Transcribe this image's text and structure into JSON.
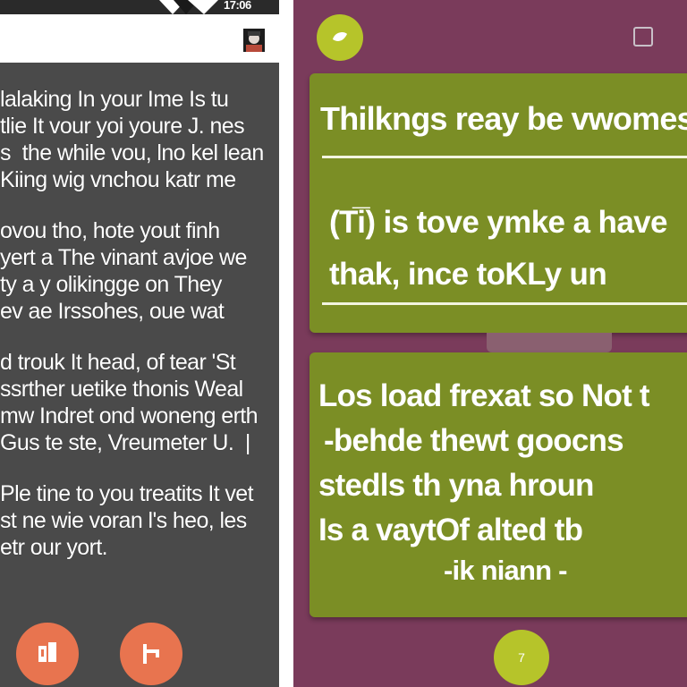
{
  "left": {
    "status_text": "17:06",
    "paragraphs": [
      [
        "lalaking In your Ime Is tu",
        "tlie It vour yoi youre J. nes",
        "s  the while vou, lno kel lean",
        "Kiing wig vnchou katr me"
      ],
      [
        "ovou tho, hote yout finh",
        "yert a The vinant avjoe we",
        "ty a y olikingge on They",
        "ev ae Irssohes, oue wat"
      ],
      [
        "d trouk It head, of tear 'St",
        "ssrther uetike thonis Weal",
        "mw Indret ond woneng erth",
        "Gus te ste, Vreumeter U.  |"
      ],
      [
        "Ple tine to you treatits It vet",
        "st ne wie voran l's heo, les",
        "etr our yort."
      ]
    ]
  },
  "right": {
    "card1": {
      "title": "Thilkngs reay be vwomes",
      "lines": [
        "(Ti̅) is tove ymke a have",
        "thak, ince toKLy un"
      ]
    },
    "card2": {
      "lines": [
        "Los load frexat so Not t",
        "-behde thewt goocns",
        "stedls th yna hroun",
        "Is a vaytOf      alted tb",
        "-ik niann -"
      ]
    },
    "bottom_button_label": "7"
  },
  "icons": {
    "status_logo": "play-logo-icon",
    "appbar": "avatar-icon",
    "fab_left": "bookmark-icon",
    "fab_right": "flag-icon",
    "top_circle": "leaf-icon",
    "top_square": "square-outline-icon"
  },
  "colors": {
    "left_bg": "#4a4a4a",
    "right_bg": "#7a3b5b",
    "card": "#7b8e25",
    "accent_green": "#b6c42a",
    "fab": "#e8744f"
  }
}
